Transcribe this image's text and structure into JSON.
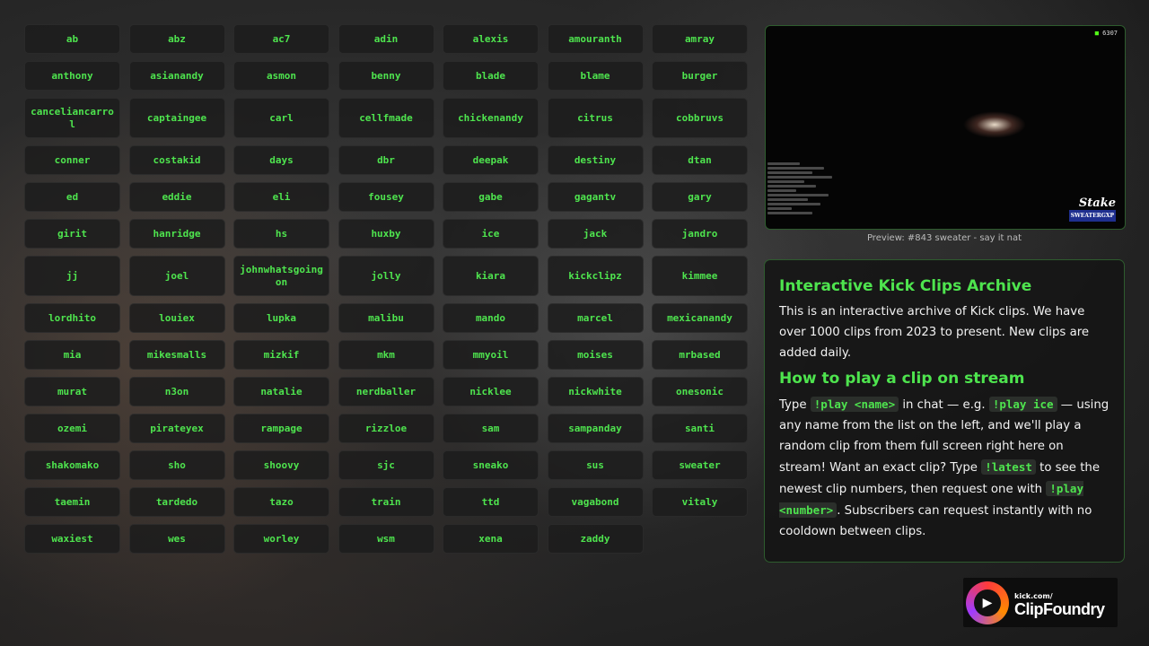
{
  "tiles": [
    [
      "ab",
      "abz",
      "ac7",
      "adin",
      "alexis",
      "amouranth",
      "amray"
    ],
    [
      "anthony",
      "asianandy",
      "asmon",
      "benny",
      "blade",
      "blame",
      "burger"
    ],
    [
      "canceliancarrol",
      "captaingee",
      "carl",
      "cellfmade",
      "chickenandy",
      "citrus",
      "cobbruvs"
    ],
    [
      "conner",
      "costakid",
      "days",
      "dbr",
      "deepak",
      "destiny",
      "dtan"
    ],
    [
      "ed",
      "eddie",
      "eli",
      "fousey",
      "gabe",
      "gagantv",
      "gary"
    ],
    [
      "girit",
      "hanridge",
      "hs",
      "huxby",
      "ice",
      "jack",
      "jandro"
    ],
    [
      "jj",
      "joel",
      "johnwhatsgoingon",
      "jolly",
      "kiara",
      "kickclipz",
      "kimmee"
    ],
    [
      "lordhito",
      "louiex",
      "lupka",
      "malibu",
      "mando",
      "marcel",
      "mexicanandy"
    ],
    [
      "mia",
      "mikesmalls",
      "mizkif",
      "mkm",
      "mmyoil",
      "moises",
      "mrbased"
    ],
    [
      "murat",
      "n3on",
      "natalie",
      "nerdballer",
      "nicklee",
      "nickwhite",
      "onesonic"
    ],
    [
      "ozemi",
      "pirateyex",
      "rampage",
      "rizzloe",
      "sam",
      "sampanday",
      "santi"
    ],
    [
      "shakomako",
      "sho",
      "shoovy",
      "sjc",
      "sneako",
      "sus",
      "sweater"
    ],
    [
      "taemin",
      "tardedo",
      "tazo",
      "train",
      "ttd",
      "vagabond",
      "vitaly"
    ],
    [
      "waxiest",
      "wes",
      "worley",
      "wsm",
      "xena",
      "zaddy"
    ]
  ],
  "preview": {
    "viewer_count": "6307",
    "sponsor_name": "Stake",
    "sponsor_tag": "SWEATERGXP",
    "caption": "Preview: #843 sweater - say it nat"
  },
  "info": {
    "title": "Interactive Kick Clips Archive",
    "intro": "This is an interactive archive of Kick clips. We have over 1000 clips from 2023 to present. New clips are added daily.",
    "how_title": "How to play a clip on stream",
    "p_type": "Type ",
    "cmd_name": "!play <name>",
    "p_eg": " in chat — e.g. ",
    "cmd_ice": "!play ice",
    "p_rest1": " — using any name from the list on the left, and we'll play a random clip from them full screen right here on stream! Want an exact clip? Type ",
    "cmd_latest": "!latest",
    "p_rest2": " to see the newest clip numbers, then request one with ",
    "cmd_number": "!play <number>",
    "p_rest3": ". Subscribers can request instantly with no cooldown between clips."
  },
  "logo": {
    "domain": "kick.com/",
    "name": "ClipFoundry"
  }
}
